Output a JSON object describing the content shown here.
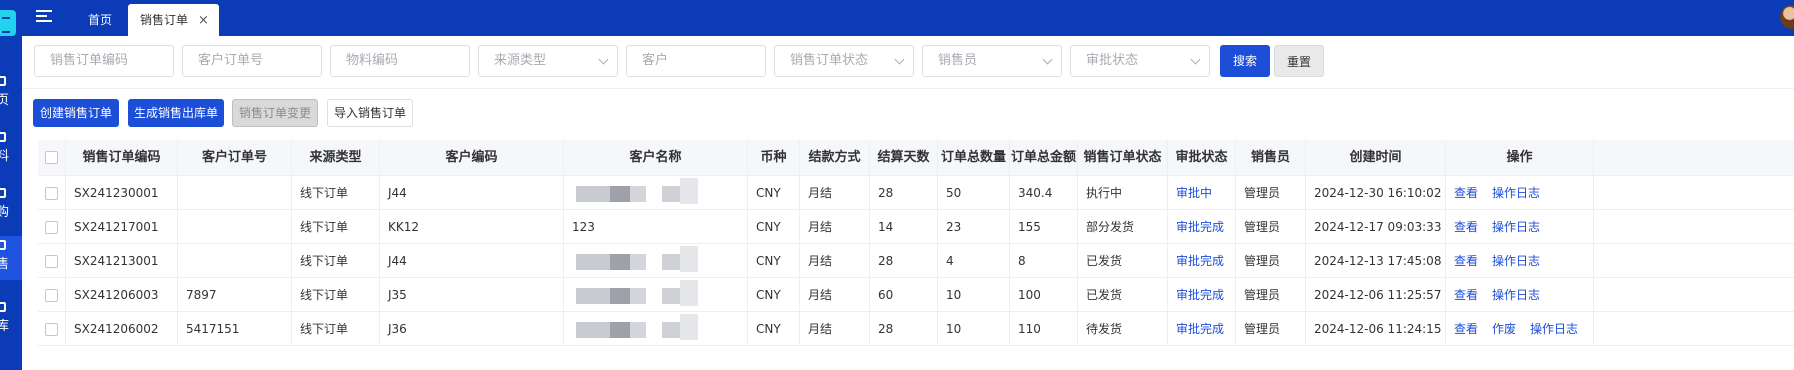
{
  "sidebar": {
    "items": [
      {
        "label": "页",
        "active": false
      },
      {
        "label": "料",
        "active": false
      },
      {
        "label": "购",
        "active": false
      },
      {
        "label": "售",
        "active": true
      },
      {
        "label": "库",
        "active": false
      }
    ]
  },
  "topbar": {
    "tabs": [
      {
        "label": "首页"
      },
      {
        "label": "销售订单",
        "close": "×"
      }
    ]
  },
  "filters": {
    "order_code": "销售订单编码",
    "customer_order_no": "客户订单号",
    "material_code": "物料编码",
    "source_type": "来源类型",
    "customer": "客户",
    "order_status": "销售订单状态",
    "salesperson": "销售员",
    "approval_status": "审批状态",
    "search_label": "搜索",
    "reset_label": "重置"
  },
  "actions": {
    "create": "创建销售订单",
    "generate_outbound": "生成销售出库单",
    "change": "销售订单变更",
    "import": "导入销售订单"
  },
  "table": {
    "headers": [
      "销售订单编码",
      "客户订单号",
      "来源类型",
      "客户编码",
      "客户名称",
      "币种",
      "结款方式",
      "结算天数",
      "订单总数量",
      "订单总金额",
      "销售订单状态",
      "审批状态",
      "销售员",
      "创建时间",
      "操作"
    ],
    "rows": [
      {
        "code": "SX241230001",
        "cust_order": "",
        "source": "线下订单",
        "cust_code": "J44",
        "cust_name": "",
        "currency": "CNY",
        "payment": "月结",
        "days": "28",
        "qty": "50",
        "amount": "340.4",
        "status": "执行中",
        "approval": "审批中",
        "sales": "管理员",
        "created": "2024-12-30 16:10:02",
        "ops": [
          "查看",
          "操作日志"
        ]
      },
      {
        "code": "SX241217001",
        "cust_order": "",
        "source": "线下订单",
        "cust_code": "KK12",
        "cust_name": "123",
        "currency": "CNY",
        "payment": "月结",
        "days": "14",
        "qty": "23",
        "amount": "155",
        "status": "部分发货",
        "approval": "审批完成",
        "sales": "管理员",
        "created": "2024-12-17 09:03:33",
        "ops": [
          "查看",
          "操作日志"
        ]
      },
      {
        "code": "SX241213001",
        "cust_order": "",
        "source": "线下订单",
        "cust_code": "J44",
        "cust_name": "",
        "currency": "CNY",
        "payment": "月结",
        "days": "28",
        "qty": "4",
        "amount": "8",
        "status": "已发货",
        "approval": "审批完成",
        "sales": "管理员",
        "created": "2024-12-13 17:45:08",
        "ops": [
          "查看",
          "操作日志"
        ]
      },
      {
        "code": "SX241206003",
        "cust_order": "7897",
        "source": "线下订单",
        "cust_code": "J35",
        "cust_name": "",
        "currency": "CNY",
        "payment": "月结",
        "days": "60",
        "qty": "10",
        "amount": "100",
        "status": "已发货",
        "approval": "审批完成",
        "sales": "管理员",
        "created": "2024-12-06 11:25:57",
        "ops": [
          "查看",
          "操作日志"
        ]
      },
      {
        "code": "SX241206002",
        "cust_order": "5417151",
        "source": "线下订单",
        "cust_code": "J36",
        "cust_name": "",
        "currency": "CNY",
        "payment": "月结",
        "days": "28",
        "qty": "10",
        "amount": "110",
        "status": "待发货",
        "approval": "审批完成",
        "sales": "管理员",
        "created": "2024-12-06 11:24:15",
        "ops": [
          "查看",
          "作废",
          "操作日志"
        ]
      }
    ]
  },
  "colors": {
    "primary": "#1d4ed8",
    "topbar": "#0b3bb6",
    "link": "#1d4ed8"
  }
}
